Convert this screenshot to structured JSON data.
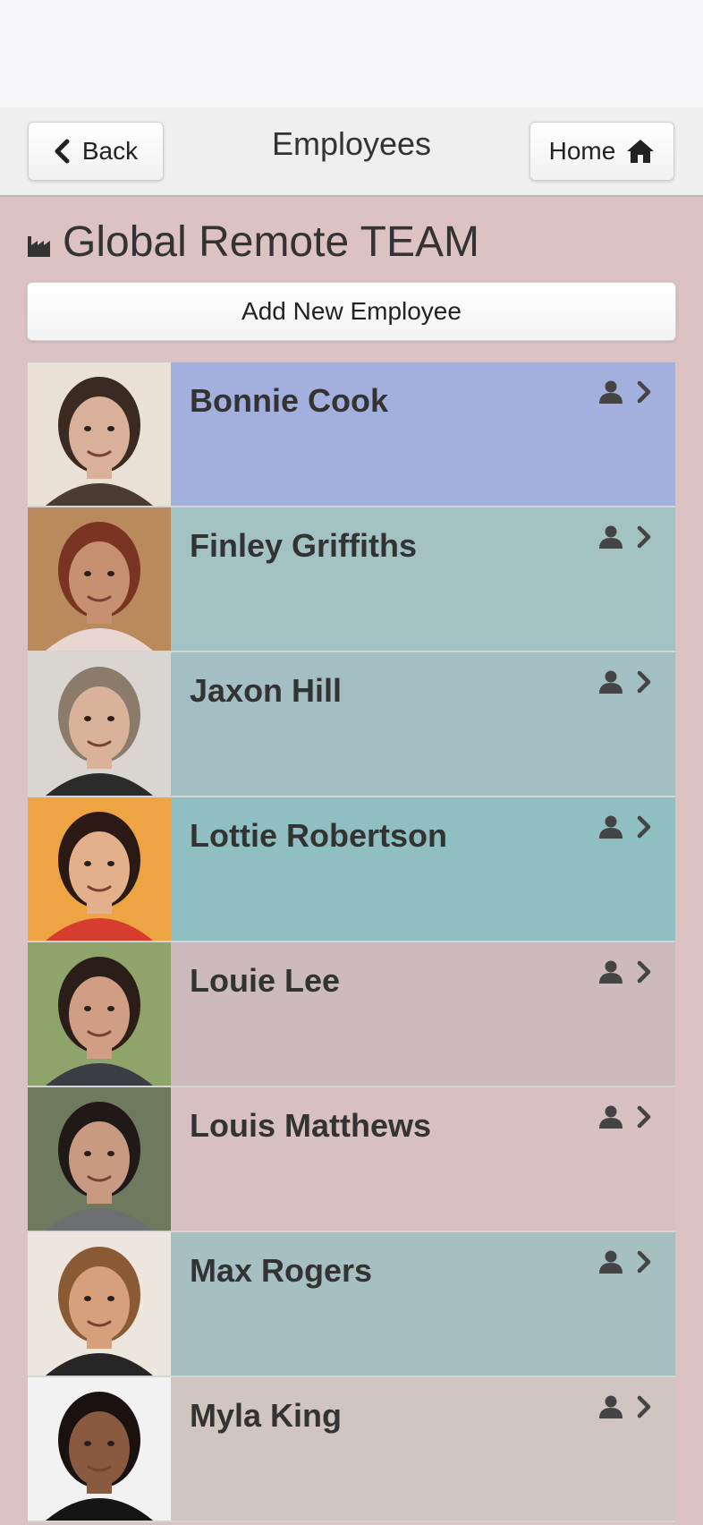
{
  "header": {
    "title": "Employees",
    "back_label": "Back",
    "home_label": "Home"
  },
  "team": {
    "title": "Global Remote TEAM",
    "icon": "factory-icon"
  },
  "add_button_label": "Add New Employee",
  "employees": [
    {
      "name": "Bonnie Cook",
      "row_color": "#a3b0dd",
      "bg": "#e9e1d6",
      "skin": "#d9b19a",
      "hair": "#3a2a22",
      "shirt": "#4a3b33"
    },
    {
      "name": "Finley Griffiths",
      "row_color": "#a3c2c2",
      "bg": "#b98a5c",
      "skin": "#c79070",
      "hair": "#7a3424",
      "shirt": "#e8d7d0"
    },
    {
      "name": "Jaxon Hill",
      "row_color": "#a4bfc3",
      "bg": "#d9d6d2",
      "skin": "#d8b39a",
      "hair": "#8b7b6a",
      "shirt": "#2b2b2b"
    },
    {
      "name": "Lottie Robertson",
      "row_color": "#90bfc2",
      "bg": "#eea443",
      "skin": "#e3b08c",
      "hair": "#2b1a14",
      "shirt": "#d63d2f"
    },
    {
      "name": "Louie Lee",
      "row_color": "#cdbabc",
      "bg": "#8fa46a",
      "skin": "#cf9e84",
      "hair": "#2b1d17",
      "shirt": "#3c3c44"
    },
    {
      "name": "Louis Matthews",
      "row_color": "#d8bfc1",
      "bg": "#6d7a5e",
      "skin": "#c89a82",
      "hair": "#1f1a18",
      "shirt": "#6c6e70"
    },
    {
      "name": "Max Rogers",
      "row_color": "#a6bfc1",
      "bg": "#ece6df",
      "skin": "#d7a07c",
      "hair": "#8a5a34",
      "shirt": "#262626"
    },
    {
      "name": "Myla King",
      "row_color": "#d1c5c2",
      "bg": "#f2f2f2",
      "skin": "#8a5a40",
      "hair": "#1a1210",
      "shirt": "#151515"
    }
  ],
  "row_icons": [
    "person-icon",
    "chevron-right-icon"
  ]
}
